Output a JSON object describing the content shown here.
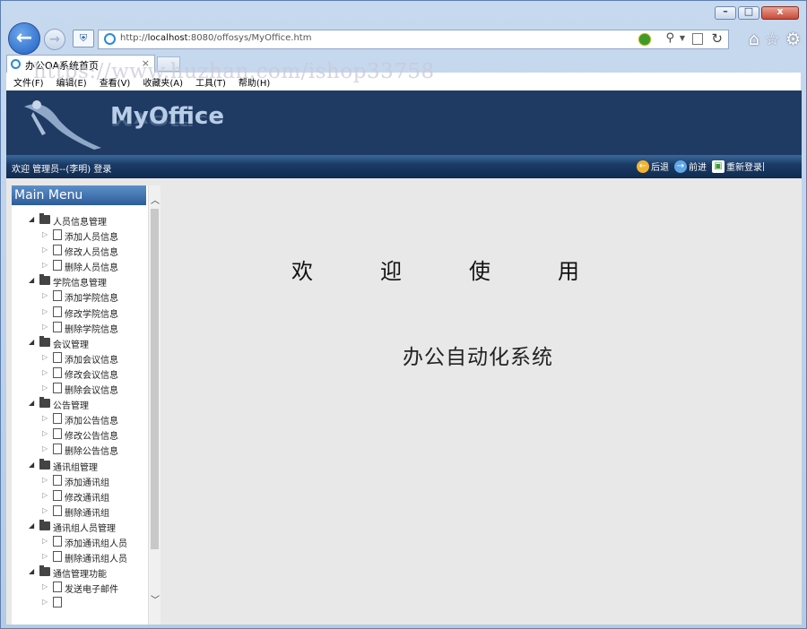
{
  "browser": {
    "url_prefix": "http://",
    "url_host": "localhost",
    "url_rest": ":8080/offosys/MyOffice.htm",
    "tab_title": "办公OA系统首页",
    "tab_close": "×",
    "minimize": "–",
    "maximize": "□",
    "close": "x",
    "menu": [
      "文件(F)",
      "编辑(E)",
      "查看(V)",
      "收藏夹(A)",
      "工具(T)",
      "帮助(H)"
    ],
    "tools_icons": [
      "home-icon",
      "star-icon",
      "gear-icon"
    ]
  },
  "watermark": "https://www.huzhan.com/ishop33758",
  "app": {
    "logo": "MyOffice",
    "welcome_text": "欢迎 管理员--(李明) 登录",
    "actions": [
      {
        "label": "后退",
        "icon": "back-arrow-icon"
      },
      {
        "label": "前进",
        "icon": "forward-arrow-icon"
      },
      {
        "label": "重新登录",
        "icon": "relogin-icon"
      }
    ],
    "colors": {
      "banner": "#1f3b63",
      "infobar": "#1b3b66",
      "sidebar_head": "#2d5d99"
    }
  },
  "sidebar": {
    "title": "Main Menu",
    "tree": [
      {
        "label": "人员信息管理",
        "children": [
          "添加人员信息",
          "修改人员信息",
          "删除人员信息"
        ]
      },
      {
        "label": "学院信息管理",
        "children": [
          "添加学院信息",
          "修改学院信息",
          "删除学院信息"
        ]
      },
      {
        "label": "会议管理",
        "children": [
          "添加会议信息",
          "修改会议信息",
          "删除会议信息"
        ]
      },
      {
        "label": "公告管理",
        "children": [
          "添加公告信息",
          "修改公告信息",
          "删除公告信息"
        ]
      },
      {
        "label": "通讯组管理",
        "children": [
          "添加通讯组",
          "修改通讯组",
          "删除通讯组"
        ]
      },
      {
        "label": "通讯组人员管理",
        "children": [
          "添加通讯组人员",
          "删除通讯组人员"
        ]
      },
      {
        "label": "通信管理功能",
        "children": [
          "发送电子邮件",
          ""
        ]
      }
    ]
  },
  "content": {
    "welcome": "欢迎使用",
    "system_name": "办公自动化系统"
  }
}
